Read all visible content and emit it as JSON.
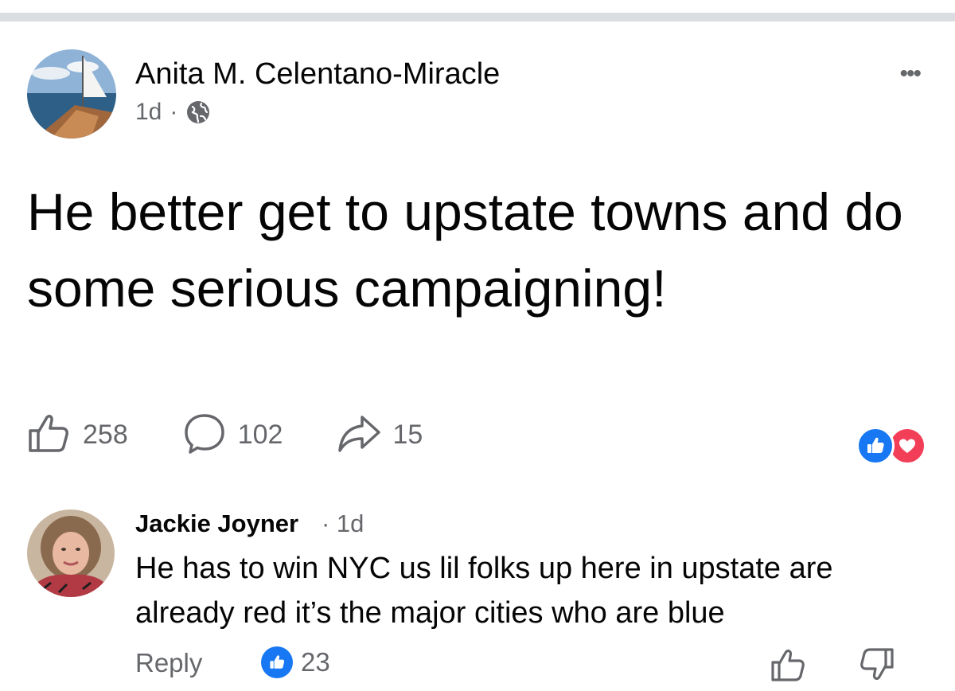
{
  "post": {
    "author": "Anita M. Celentano-Miracle",
    "time": "1d",
    "separator": "·",
    "privacy_icon": "globe-icon",
    "more_label": "•••",
    "text": "He better get to upstate towns and do some serious campaigning!",
    "stats": {
      "likes": "258",
      "comments": "102",
      "shares": "15"
    },
    "reactions": [
      "like",
      "love"
    ]
  },
  "comment": {
    "author": "Jackie Joyner",
    "time": "· 1d",
    "text": "He has to win NYC us lil folks up here in upstate are already red it’s the major cities who are blue",
    "reply_label": "Reply",
    "like_count": "23"
  },
  "colors": {
    "accent": "#1877f2",
    "love": "#f33e58",
    "secondary_text": "#65676b",
    "divider": "#dadde1"
  }
}
